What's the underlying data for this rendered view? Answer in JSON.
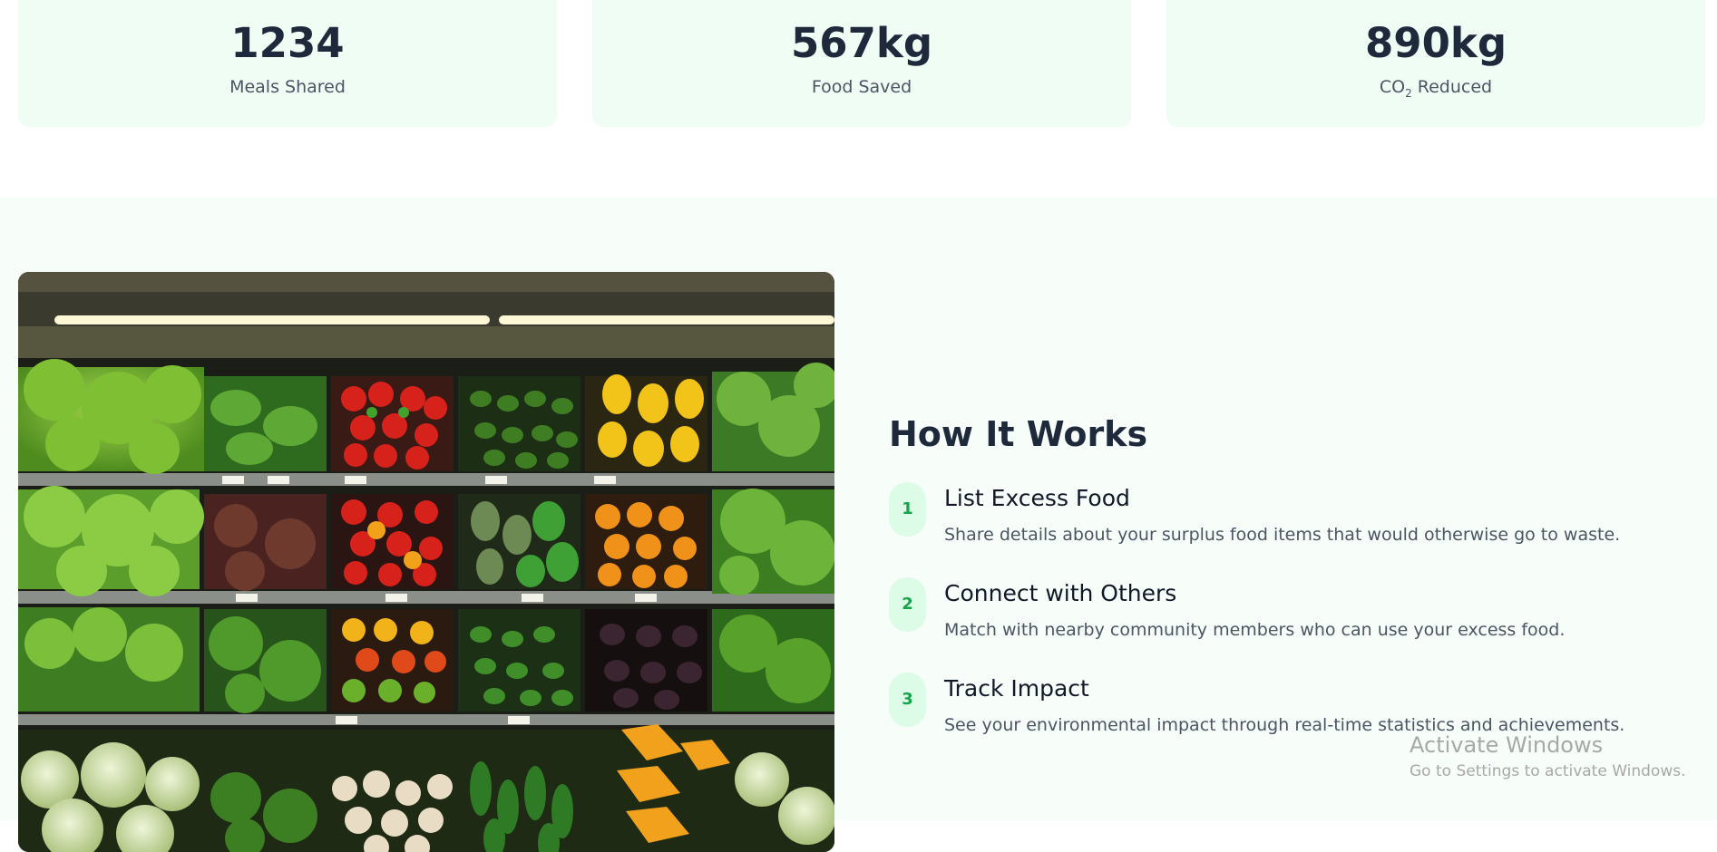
{
  "stats": [
    {
      "value": "1234",
      "label": "Meals Shared"
    },
    {
      "value": "567kg",
      "label": "Food Saved"
    },
    {
      "value": "890kg",
      "label_main": "CO",
      "label_sub": "2",
      "label_rest": " Reduced"
    }
  ],
  "how_it_works": {
    "title": "How It Works",
    "image_alt": "Supermarket shelves stocked with fresh vegetables",
    "steps": [
      {
        "number": "1",
        "title": "List Excess Food",
        "description": "Share details about your surplus food items that would otherwise go to waste."
      },
      {
        "number": "2",
        "title": "Connect with Others",
        "description": "Match with nearby community members who can use your excess food."
      },
      {
        "number": "3",
        "title": "Track Impact",
        "description": "See your environmental impact through real-time statistics and achievements."
      }
    ]
  },
  "watermark": {
    "title": "Activate Windows",
    "subtitle": "Go to Settings to activate Windows."
  },
  "colors": {
    "accent": "#16a34a",
    "accent_bg": "#dcfce7",
    "card_bg": "#f0fdf4",
    "section_bg": "#f7fdf9"
  }
}
